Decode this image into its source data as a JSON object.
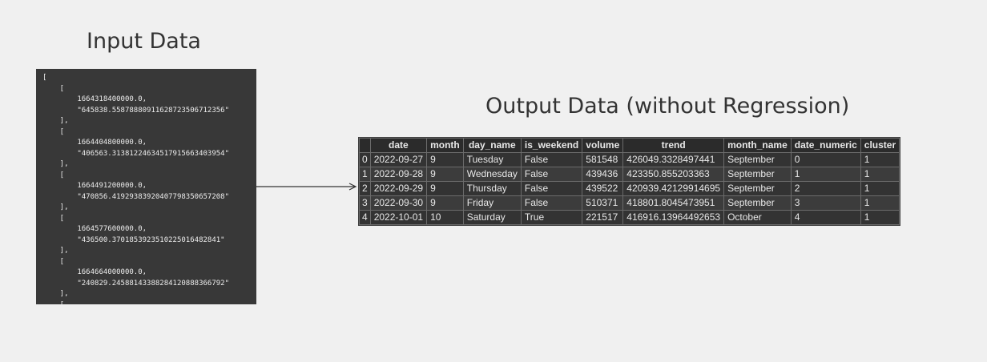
{
  "input": {
    "title": "Input Data",
    "code_lines": [
      "[",
      "    [",
      "        1664318400000.0,",
      "        \"645838.5587888091162872350671235​6\"",
      "    ],",
      "    [",
      "        1664404800000.0,",
      "        \"406563.3138122463451791566340395​4\"",
      "    ],",
      "    [",
      "        1664491200000.0,",
      "        \"470856.4192938392040779835065720​8\"",
      "    ],",
      "    [",
      "        1664577600000.0,",
      "        \"436500.3701853923510225016482841\"",
      "    ],",
      "    [",
      "        1664664000000.0,",
      "        \"240829.2458814338828412088836679​2\"",
      "    ],",
      "    ["
    ]
  },
  "output": {
    "title": "Output Data (without Regression)",
    "table": {
      "columns": [
        "",
        "date",
        "month",
        "day_name",
        "is_weekend",
        "volume",
        "trend",
        "month_name",
        "date_numeric",
        "cluster"
      ],
      "rows": [
        [
          "0",
          "2022-09-27",
          "9",
          "Tuesday",
          "False",
          "581548",
          "426049.3328497441",
          "September",
          "0",
          "1"
        ],
        [
          "1",
          "2022-09-28",
          "9",
          "Wednesday",
          "False",
          "439436",
          "423350.855203363",
          "September",
          "1",
          "1"
        ],
        [
          "2",
          "2022-09-29",
          "9",
          "Thursday",
          "False",
          "439522",
          "420939.42129914695",
          "September",
          "2",
          "1"
        ],
        [
          "3",
          "2022-09-30",
          "9",
          "Friday",
          "False",
          "510371",
          "418801.8045473951",
          "September",
          "3",
          "1"
        ],
        [
          "4",
          "2022-10-01",
          "10",
          "Saturday",
          "True",
          "221517",
          "416916.13964492653",
          "October",
          "4",
          "1"
        ]
      ]
    }
  },
  "colors": {
    "background": "#f0f0f0",
    "panel": "#383838",
    "title_text": "#333333",
    "arrow": "#333333"
  }
}
